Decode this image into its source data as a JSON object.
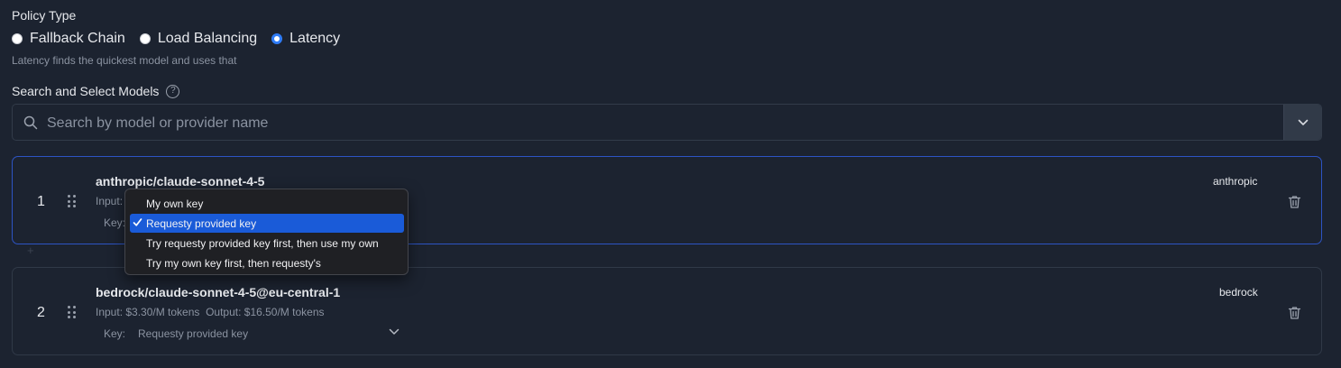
{
  "policy": {
    "label": "Policy Type",
    "options": [
      {
        "label": "Fallback Chain",
        "selected": false
      },
      {
        "label": "Load Balancing",
        "selected": false
      },
      {
        "label": "Latency",
        "selected": true
      }
    ],
    "hint": "Latency finds the quickest model and uses that"
  },
  "models_section": {
    "label": "Search and Select Models",
    "help_icon": "question-circle-icon",
    "search_placeholder": "Search by model or provider name",
    "search_value": ""
  },
  "models": [
    {
      "rank": "1",
      "name": "anthropic/claude-sonnet-4-5",
      "pricing": "Input:",
      "key_label": "Key:",
      "key_value": "Requesty provided key",
      "provider": "anthropic"
    },
    {
      "rank": "2",
      "name": "bedrock/claude-sonnet-4-5@eu-central-1",
      "pricing": "Input: $3.30/M tokens  Output: $16.50/M tokens",
      "key_label": "Key:",
      "key_value": "Requesty provided key",
      "provider": "bedrock"
    }
  ],
  "key_menu": {
    "options": [
      {
        "label": "My own key",
        "selected": false
      },
      {
        "label": "Requesty provided key",
        "selected": true
      },
      {
        "label": "Try requesty provided key first, then use my own",
        "selected": false
      },
      {
        "label": "Try my own key first, then requesty's",
        "selected": false
      }
    ]
  },
  "add_symbol": "+",
  "colors": {
    "background": "#1c2330",
    "accent": "#2f7cf6",
    "active_border": "#2d54c4",
    "menu_selected": "#1a5bd8"
  }
}
